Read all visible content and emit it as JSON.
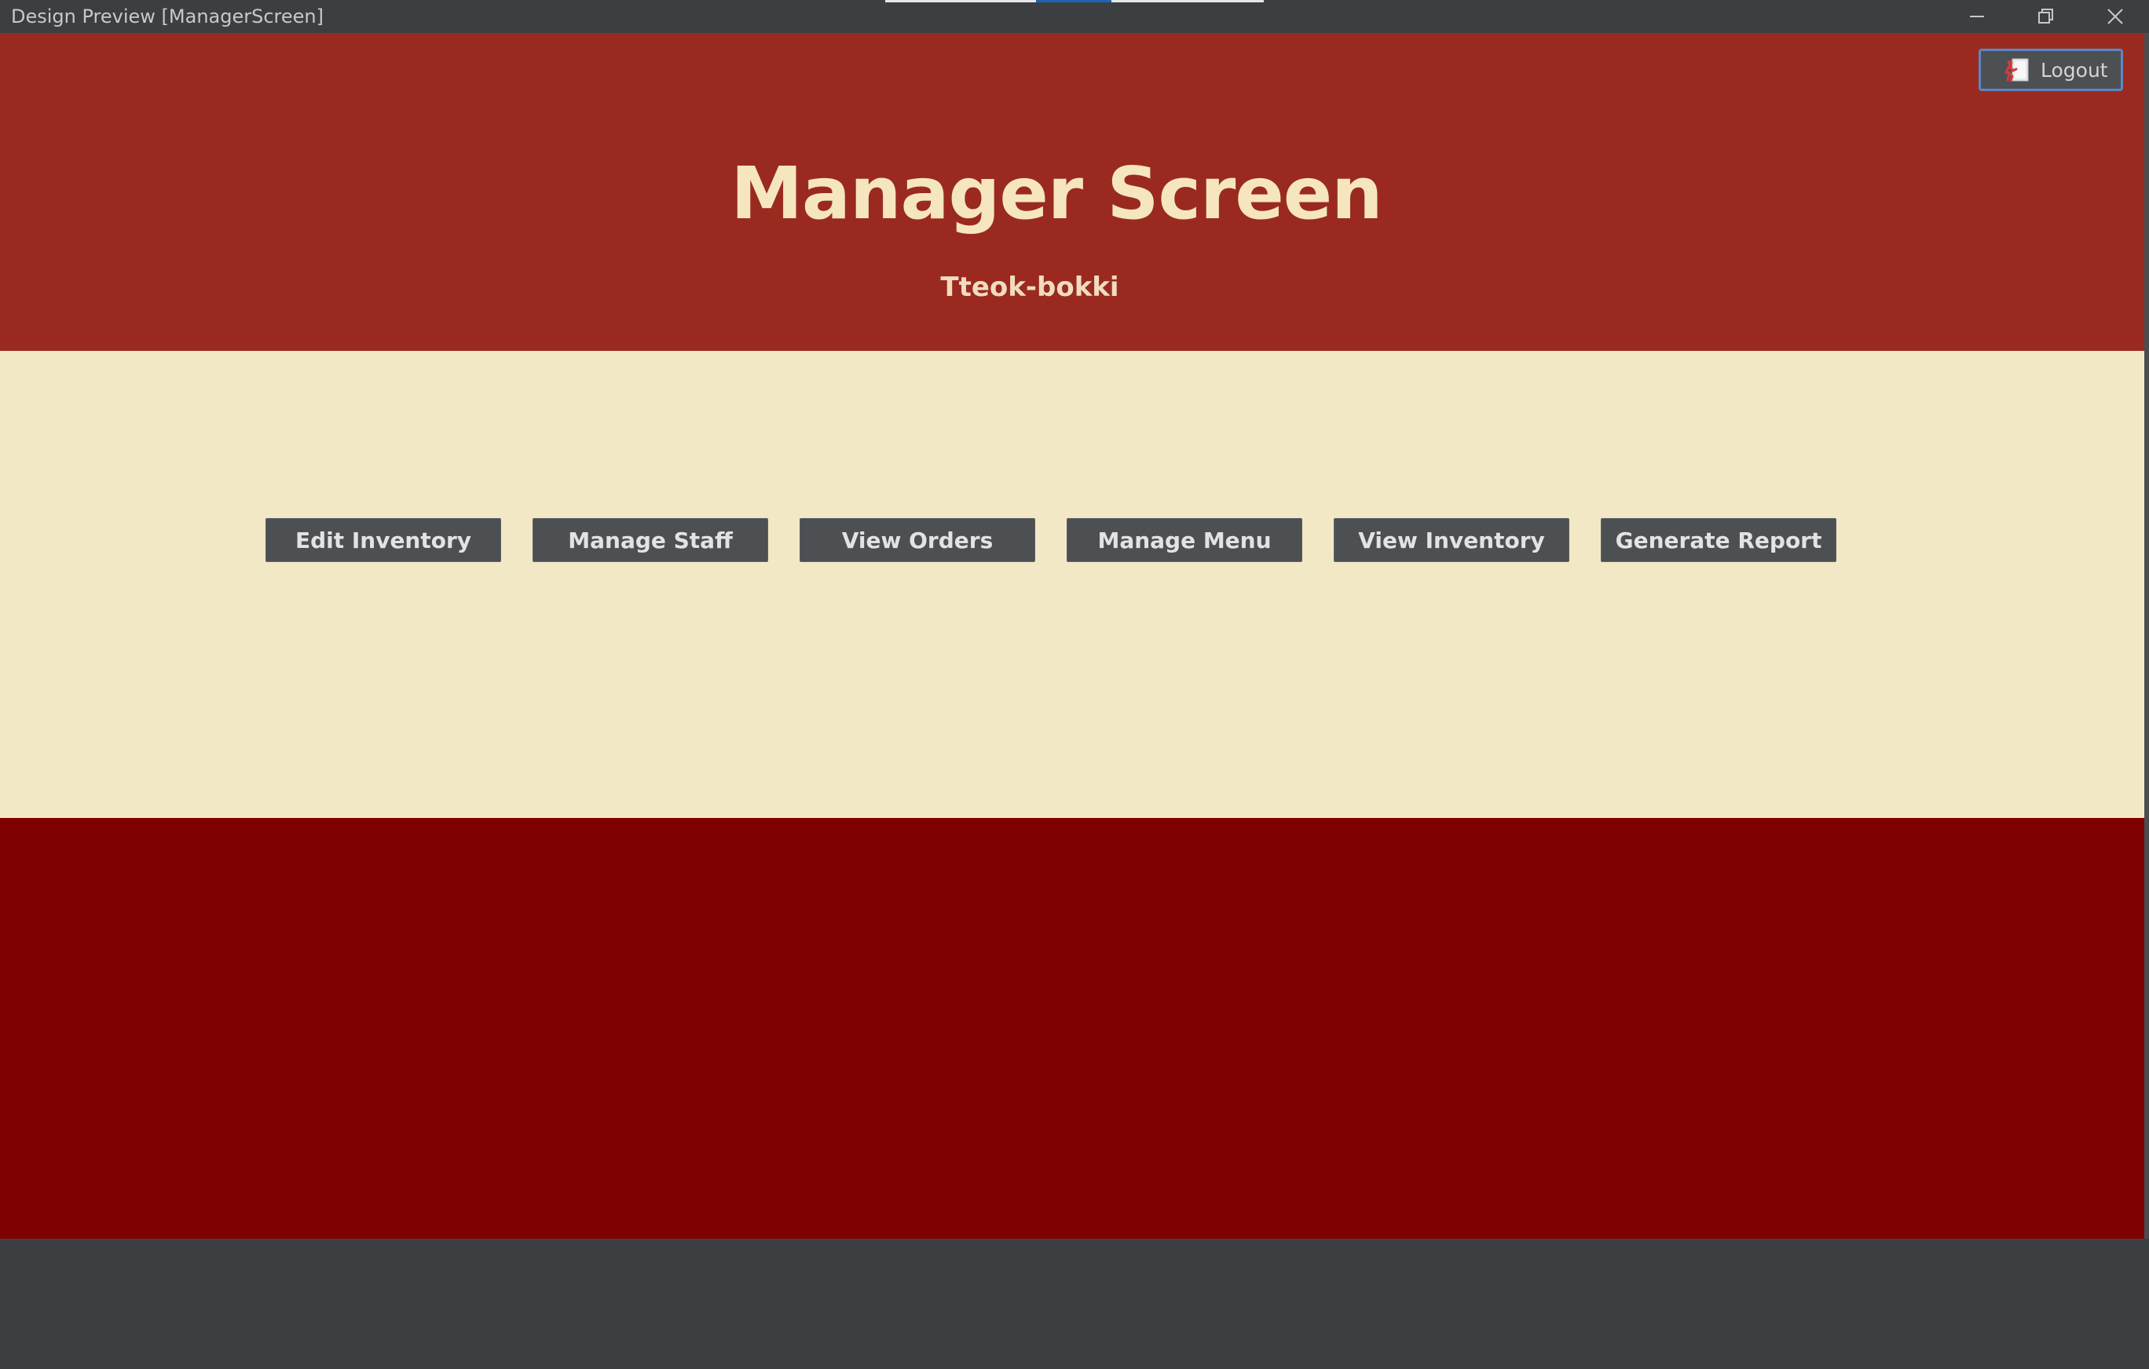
{
  "window": {
    "title": "Design Preview [ManagerScreen]",
    "controls": {
      "minimize_icon": "minimize-icon",
      "restore_icon": "restore-icon",
      "close_icon": "close-icon"
    },
    "loading_progress": 0.2
  },
  "header": {
    "title": "Manager Screen",
    "subtitle": "Tteok-bokki",
    "logout_label": "Logout",
    "logout_icon": "exit-door-icon"
  },
  "actions": [
    {
      "label": "Edit Inventory"
    },
    {
      "label": "Manage Staff"
    },
    {
      "label": "View Orders"
    },
    {
      "label": "Manage Menu"
    },
    {
      "label": "View Inventory"
    },
    {
      "label": "Generate Report"
    }
  ],
  "colors": {
    "header_bg": "#9a2a1f",
    "middle_bg": "#f3e8c6",
    "footer_bg": "#7f0000",
    "title_text": "#f5e6c0",
    "subtitle_text": "#f0dcc0",
    "window_chrome": "#3c3f41",
    "progress_accent": "#1e64b4",
    "button_bg": "#4d5052"
  }
}
